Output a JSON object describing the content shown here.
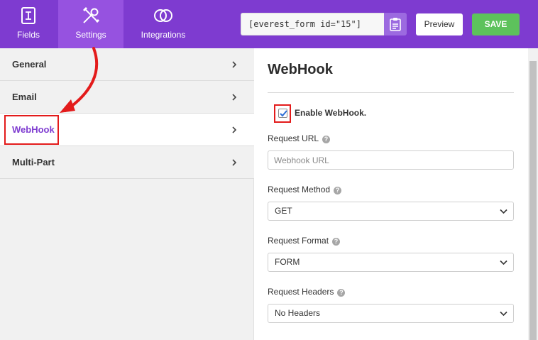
{
  "tabs": [
    {
      "label": "Fields",
      "icon": "fields-icon"
    },
    {
      "label": "Settings",
      "icon": "settings-tools-icon"
    },
    {
      "label": "Integrations",
      "icon": "integrations-rings-icon"
    }
  ],
  "shortcode": "[everest_form id=\"15\"]",
  "toolbar": {
    "preview_label": "Preview",
    "save_label": "SAVE"
  },
  "sidebar": {
    "items": [
      {
        "label": "General"
      },
      {
        "label": "Email"
      },
      {
        "label": "WebHook"
      },
      {
        "label": "Multi-Part"
      }
    ],
    "active": "WebHook"
  },
  "main": {
    "title": "WebHook",
    "enable_label": "Enable WebHook.",
    "enable_checked": true,
    "request_url": {
      "label": "Request URL",
      "placeholder": "Webhook URL",
      "value": ""
    },
    "request_method": {
      "label": "Request Method",
      "value": "GET"
    },
    "request_format": {
      "label": "Request Format",
      "value": "FORM"
    },
    "request_headers": {
      "label": "Request Headers",
      "value": "No Headers"
    }
  },
  "colors": {
    "brand_purple": "#7e3bd0",
    "save_green": "#5dc25c",
    "annotation_red": "#e31b1b"
  }
}
